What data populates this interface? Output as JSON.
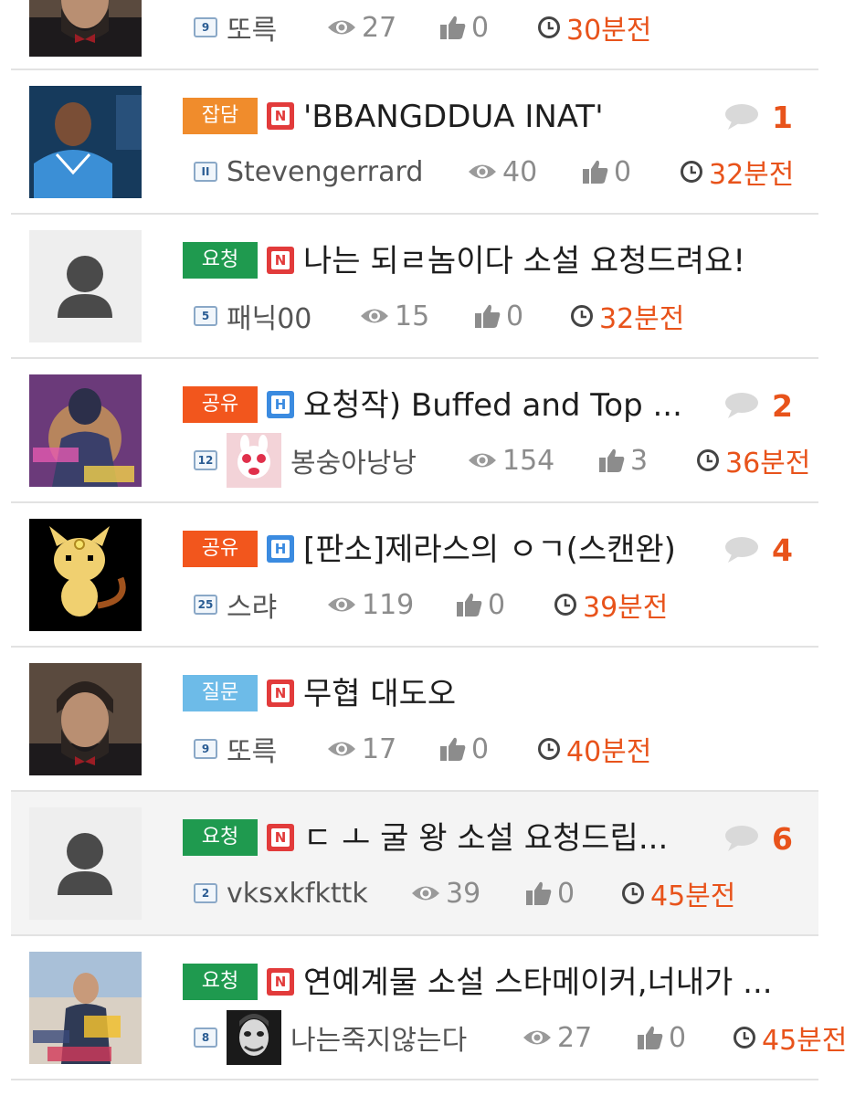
{
  "colors": {
    "accent": "#e8531b",
    "cat_chat": "#f08c2c",
    "cat_request": "#1f9a4f",
    "cat_share": "#f2561d",
    "cat_question": "#6dbbe8",
    "badge_new": "#e23b3b",
    "badge_hot": "#3b8be0"
  },
  "icons": {
    "views": "eye-icon",
    "likes": "thumbs-up-icon",
    "time": "clock-icon",
    "comments": "speech-bubble-icon",
    "default_avatar": "user-silhouette-icon"
  },
  "posts": [
    {
      "category": "",
      "badge": "",
      "title": "",
      "level": "9",
      "author": "또륵",
      "views": "27",
      "likes": "0",
      "time": "30분전",
      "comments": ""
    },
    {
      "category": "잡담",
      "badge": "N",
      "title": "'BBANGDDUA INAT'",
      "level": "II",
      "author": "Stevengerrard",
      "views": "40",
      "likes": "0",
      "time": "32분전",
      "comments": "1"
    },
    {
      "category": "요청",
      "badge": "N",
      "title": "나는 되ㄹ놈이다 소설 요청드려요!",
      "level": "5",
      "author": "패닉00",
      "views": "15",
      "likes": "0",
      "time": "32분전",
      "comments": ""
    },
    {
      "category": "공유",
      "badge": "H",
      "title": "요청작) Buffed and Top ...",
      "level": "12",
      "author": "봉숭아낭낭",
      "views": "154",
      "likes": "3",
      "time": "36분전",
      "comments": "2"
    },
    {
      "category": "공유",
      "badge": "H",
      "title": "[판소]제라스의 ㅇㄱ(스캔완)",
      "level": "25",
      "author": "스랴",
      "views": "119",
      "likes": "0",
      "time": "39분전",
      "comments": "4"
    },
    {
      "category": "질문",
      "badge": "N",
      "title": "무협 대도오",
      "level": "9",
      "author": "또륵",
      "views": "17",
      "likes": "0",
      "time": "40분전",
      "comments": ""
    },
    {
      "category": "요청",
      "badge": "N",
      "title": "ㄷ ㅗ 굴 왕 소설 요청드립...",
      "level": "2",
      "author": "vksxkfkttk",
      "views": "39",
      "likes": "0",
      "time": "45분전",
      "comments": "6"
    },
    {
      "category": "요청",
      "badge": "N",
      "title": "연예계물 소설 스타메이커,너내가 ...",
      "level": "8",
      "author": "나는죽지않는다",
      "views": "27",
      "likes": "0",
      "time": "45분전",
      "comments": ""
    }
  ]
}
